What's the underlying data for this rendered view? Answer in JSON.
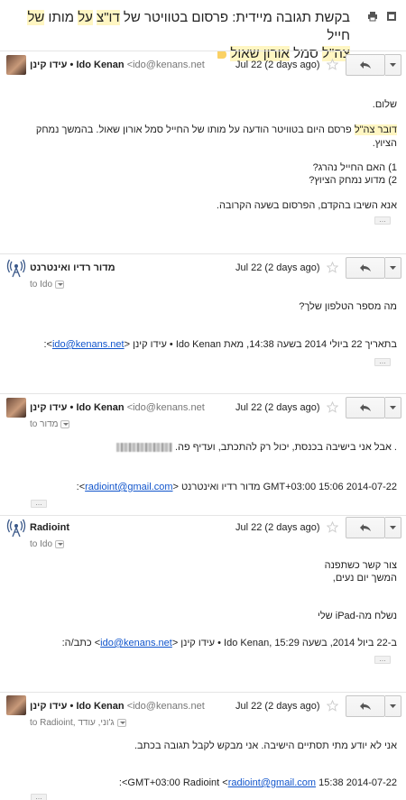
{
  "subject": {
    "text_main": "בקשת תגובה מיידית: פרסום בטוויטר של ",
    "text_hl1": "דו\"צ",
    "text_mid1": " ",
    "text_hl2": "על",
    "text_mid2": " מותו ",
    "text_hl3": "של",
    "text_mid3": " חייל",
    "line2_hl": "צה\"ל",
    "line2_mid": " סמל ",
    "line2_hl2": "אורון שאול",
    "label_color": "#fad165"
  },
  "messages": [
    {
      "sender_name": "עידו קינן • Ido Kenan",
      "sender_addr": "<ido@kenans.net",
      "date": "Jul 22 (2 days ago)",
      "body": {
        "greeting": "שלום.",
        "para1_hl": "דובר צה\"ל",
        "para1_rest": " פרסם היום בטוויטר הודעה על מותו של החייל סמל אורון שאול. בהמשך נמחק הציוץ.",
        "q1": "1) האם החייל נהרג?",
        "q2": "2) מדוע נמחק הציוץ?",
        "closing": "אנא השיבו בהקדם, הפרסום בשעה הקרובה."
      }
    },
    {
      "sender_name": "מדור רדיו ואינטרנט",
      "date": "Jul 22 (2 days ago)",
      "to": "to Ido",
      "body": {
        "line1": "מה מספר הטלפון שלך?",
        "quote_pre": "בתאריך 22 ביולי 2014 בשעה 14:38, מאת Ido Kenan • עידו קינן <",
        "quote_link": "ido@kenans.net",
        "quote_post": ">:"
      }
    },
    {
      "sender_name": "עידו קינן • Ido Kenan",
      "sender_addr": "<ido@kenans.net",
      "date": "Jul 22 (2 days ago)",
      "to": "to מדור",
      "body": {
        "line1": ". אבל אני בישיבה בכנסת, יכול רק להתכתב, ועדיף פה.",
        "quote_pre": "2014-07-22 15:06 GMT+03:00 מדור רדיו ואינטרנט <",
        "quote_link": "radioint@gmail.com",
        "quote_post": ">:"
      }
    },
    {
      "sender_name": "Radioint",
      "date": "Jul 22 (2 days ago)",
      "to": "to Ido",
      "body": {
        "line1": "צור קשר כשתפנה",
        "line2": "המשך יום נעים,",
        "line3": "נשלח מה-iPad שלי",
        "quote_pre": "ב-22 ביול 2014, בשעה 15:29 ,Ido Kenan • עידו קינן <",
        "quote_link": "ido@kenans.net",
        "quote_post": "> כתב/ה:"
      }
    },
    {
      "sender_name": "עידו קינן • Ido Kenan",
      "sender_addr": "<ido@kenans.net",
      "date": "Jul 22 (2 days ago)",
      "to": "to Radioint, ג'וני, עודד",
      "body": {
        "line1": "אני לא יודע מתי תסתיים הישיבה. אני מבקש לקבל תגובה בכתב.",
        "quote_pre": "2014-07-22 15:38 GMT+03:00 Radioint <",
        "quote_link": "radioint@gmail.com",
        "quote_post": ">:"
      }
    }
  ]
}
